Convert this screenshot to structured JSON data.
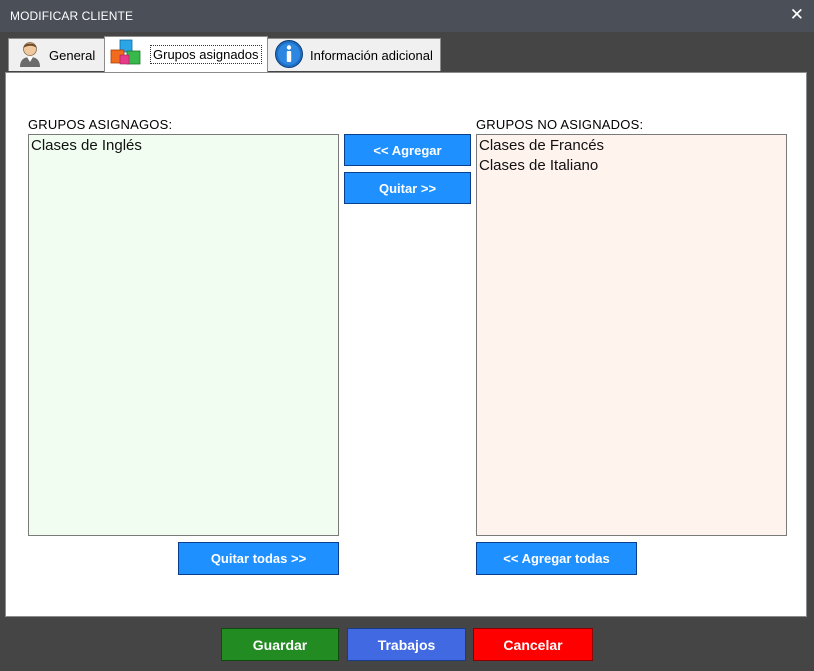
{
  "window": {
    "title": "MODIFICAR CLIENTE",
    "close_glyph": "✕"
  },
  "tabs": [
    {
      "label": "General",
      "icon": "user-icon"
    },
    {
      "label": "Grupos asignados",
      "icon": "cubes-icon",
      "active": true
    },
    {
      "label": "Información adicional",
      "icon": "info-icon"
    }
  ],
  "assigned": {
    "title": "GRUPOS ASIGNAGOS:",
    "items": [
      "Clases de Inglés"
    ],
    "bg": "#f0fdf0"
  },
  "unassigned": {
    "title": "GRUPOS NO ASIGNADOS:",
    "items": [
      "Clases de Francés",
      "Clases de Italiano"
    ],
    "bg": "#fff3ee"
  },
  "buttons": {
    "add": "<< Agregar",
    "remove": "Quitar >>",
    "remove_all": "Quitar todas >>",
    "add_all": "<< Agregar todas"
  },
  "footer": {
    "save": {
      "label": "Guardar",
      "color": "#228b22"
    },
    "jobs": {
      "label": "Trabajos",
      "color": "#4169e1"
    },
    "cancel": {
      "label": "Cancelar",
      "color": "#ff0000"
    }
  },
  "colors": {
    "primary_button": "#1e90ff",
    "titlebar": "#4a4f58",
    "frame": "#454545"
  }
}
